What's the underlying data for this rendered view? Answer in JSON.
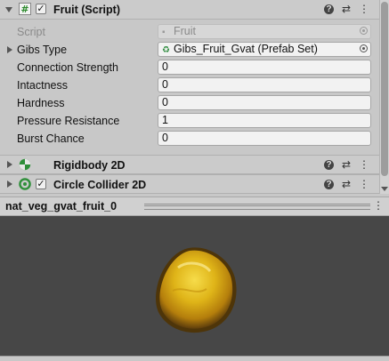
{
  "components": {
    "fruit": {
      "title": "Fruit (Script)",
      "icon": "script-hash-icon",
      "enabled": true,
      "checkbox_mark": "✓",
      "properties": [
        {
          "label": "Script",
          "value": "Fruit",
          "disabled": true,
          "type": "object"
        },
        {
          "label": "Gibs Type",
          "value": "Gibs_Fruit_Gvat (Prefab Set)",
          "type": "object",
          "foldout": true
        },
        {
          "label": "Connection Strength",
          "value": "0"
        },
        {
          "label": "Intactness",
          "value": "0"
        },
        {
          "label": "Hardness",
          "value": "0"
        },
        {
          "label": "Pressure Resistance",
          "value": "1"
        },
        {
          "label": "Burst Chance",
          "value": "0"
        }
      ]
    },
    "rigidbody": {
      "title": "Rigidbody 2D",
      "icon": "rigidbody2d-icon"
    },
    "collider": {
      "title": "Circle Collider 2D",
      "icon": "circle-collider-icon",
      "enabled": true,
      "checkbox_mark": "✓"
    }
  },
  "header_buttons": {
    "help": "?",
    "presets": "⇄",
    "menu": "⋮"
  },
  "preview": {
    "title": "nat_veg_gvat_fruit_0",
    "menu": "⋮",
    "background": "#474747",
    "sprite_colors": {
      "outer": "#6e4a0e",
      "mid": "#d09a10",
      "inner": "#f3d53a"
    }
  },
  "colors": {
    "inspector_bg": "#c8c8c8",
    "field_bg": "#f2f2f2"
  }
}
